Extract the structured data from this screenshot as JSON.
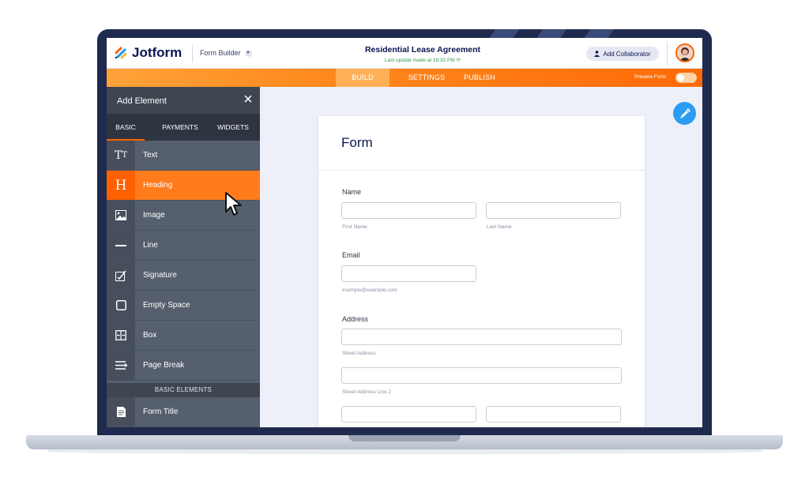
{
  "topbar": {
    "brand": "Jotform",
    "builder_label": "Form Builder",
    "doc_title": "Residential Lease Agreement",
    "doc_subtitle": "Last update made at 16:32 PM",
    "collab_label": "Add Collaborator"
  },
  "nav": {
    "tabs": [
      "BUILD",
      "SETTINGS",
      "PUBLISH"
    ],
    "active_tab": "BUILD",
    "preview_label": "Preview Form",
    "preview_on": false
  },
  "panel": {
    "title": "Add Element",
    "tabs": [
      "BASIC",
      "PAYMENTS",
      "WIDGETS"
    ],
    "active_tab": "BASIC",
    "items": [
      {
        "label": "Text",
        "icon": "text-icon"
      },
      {
        "label": "Heading",
        "icon": "heading-icon"
      },
      {
        "label": "Image",
        "icon": "image-icon"
      },
      {
        "label": "Line",
        "icon": "line-icon"
      },
      {
        "label": "Signature",
        "icon": "signature-icon"
      },
      {
        "label": "Empty Space",
        "icon": "empty-space-icon"
      },
      {
        "label": "Box",
        "icon": "box-icon"
      },
      {
        "label": "Page Break",
        "icon": "page-break-icon"
      }
    ],
    "active_item": "Heading",
    "section_label": "BASIC ELEMENTS",
    "section_items": [
      {
        "label": "Form Title",
        "icon": "form-title-icon"
      }
    ]
  },
  "form": {
    "heading": "Form",
    "name_label": "Name",
    "first_name_sub": "First Name",
    "last_name_sub": "Last Name",
    "email_label": "Email",
    "email_sub": "example@example.com",
    "address_label": "Address",
    "street_sub": "Street Address",
    "street2_sub": "Street Address Line 2"
  },
  "colors": {
    "brand_orange": "#ff6100",
    "navy": "#0a1551",
    "panel_gray": "#555f6e",
    "accent_blue": "#2d9cf3"
  }
}
